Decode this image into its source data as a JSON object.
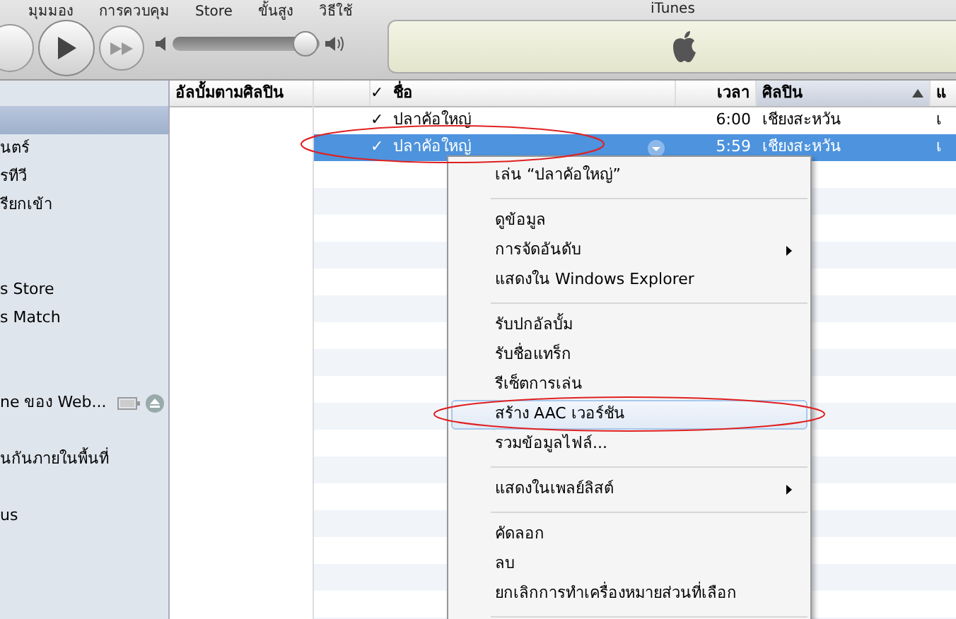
{
  "menu_bar": [
    "มุมมอง",
    "การควบคุม",
    "Store",
    "ขั้นสูง",
    "วิธีใช้"
  ],
  "window": {
    "title": "iTunes"
  },
  "volume": {
    "level": 0.9
  },
  "sidebar": {
    "items": [
      {
        "kind": "item",
        "selected": true
      },
      {
        "kind": "item",
        "label": "นตร์",
        "selected": false
      },
      {
        "kind": "item",
        "label": "รทีวี",
        "selected": false
      },
      {
        "kind": "item",
        "label": "รียกเข้า",
        "selected": false
      },
      {
        "kind": "spacer"
      },
      {
        "kind": "spacer"
      },
      {
        "kind": "item",
        "label": "s Store",
        "selected": false
      },
      {
        "kind": "item",
        "label": "s Match",
        "selected": false
      },
      {
        "kind": "spacer"
      },
      {
        "kind": "spacer"
      },
      {
        "kind": "device",
        "label": "ne ของ Web...",
        "selected": false
      },
      {
        "kind": "spacer"
      },
      {
        "kind": "item",
        "label": "นกันภายในพื้นที่",
        "selected": false
      },
      {
        "kind": "spacer"
      },
      {
        "kind": "item",
        "label": "us",
        "selected": false
      }
    ]
  },
  "album_column": {
    "title": "อัลบั้มตามศิลปิน"
  },
  "table": {
    "columns": [
      {
        "label": "✓"
      },
      {
        "label": "ชื่อ"
      },
      {
        "label": "เวลา"
      },
      {
        "label": "ศิลปิน",
        "sorted": true
      },
      {
        "label": "แ"
      }
    ],
    "rows": [
      {
        "check": "✓",
        "name": "ปลาคัอใหญ่",
        "time": "6:00",
        "artist": "เชียงสะหวัน",
        "column_5": "เ",
        "selected": false
      },
      {
        "check": "✓",
        "name": "ปลาคัอใหญ่",
        "time": "5:59",
        "artist": "เชียงสะหวัน",
        "column_5": "เ",
        "selected": true
      }
    ]
  },
  "context_menu": {
    "items": [
      {
        "kind": "item",
        "label": "เล่น “ปลาคัอใหญ่”",
        "submenu": false,
        "highlighted": false
      },
      {
        "kind": "separator"
      },
      {
        "kind": "item",
        "label": "ดูข้อมูล",
        "submenu": false,
        "highlighted": false
      },
      {
        "kind": "item",
        "label": "การจัดอันดับ",
        "submenu": true,
        "highlighted": false
      },
      {
        "kind": "item",
        "label": "แสดงใน Windows Explorer",
        "submenu": false,
        "highlighted": false
      },
      {
        "kind": "separator"
      },
      {
        "kind": "item",
        "label": "รับปกอัลบั้ม",
        "submenu": false,
        "highlighted": false
      },
      {
        "kind": "item",
        "label": "รับชื่อแทร็ก",
        "submenu": false,
        "highlighted": false
      },
      {
        "kind": "item",
        "label": "รีเซ็ตการเล่น",
        "submenu": false,
        "highlighted": false
      },
      {
        "kind": "item",
        "label": "สร้าง AAC เวอร์ชัน",
        "submenu": false,
        "highlighted": true
      },
      {
        "kind": "item",
        "label": "รวมข้อมูลไฟล์...",
        "submenu": false,
        "highlighted": false
      },
      {
        "kind": "separator"
      },
      {
        "kind": "item",
        "label": "แสดงในเพลย์ลิสต์",
        "submenu": true,
        "highlighted": false
      },
      {
        "kind": "separator"
      },
      {
        "kind": "item",
        "label": "คัดลอก",
        "submenu": false,
        "highlighted": false
      },
      {
        "kind": "item",
        "label": "ลบ",
        "submenu": false,
        "highlighted": false
      },
      {
        "kind": "item",
        "label": "ยกเลิกการทำเครื่องหมายส่วนที่เลือก",
        "submenu": false,
        "highlighted": false
      },
      {
        "kind": "separator"
      }
    ]
  }
}
